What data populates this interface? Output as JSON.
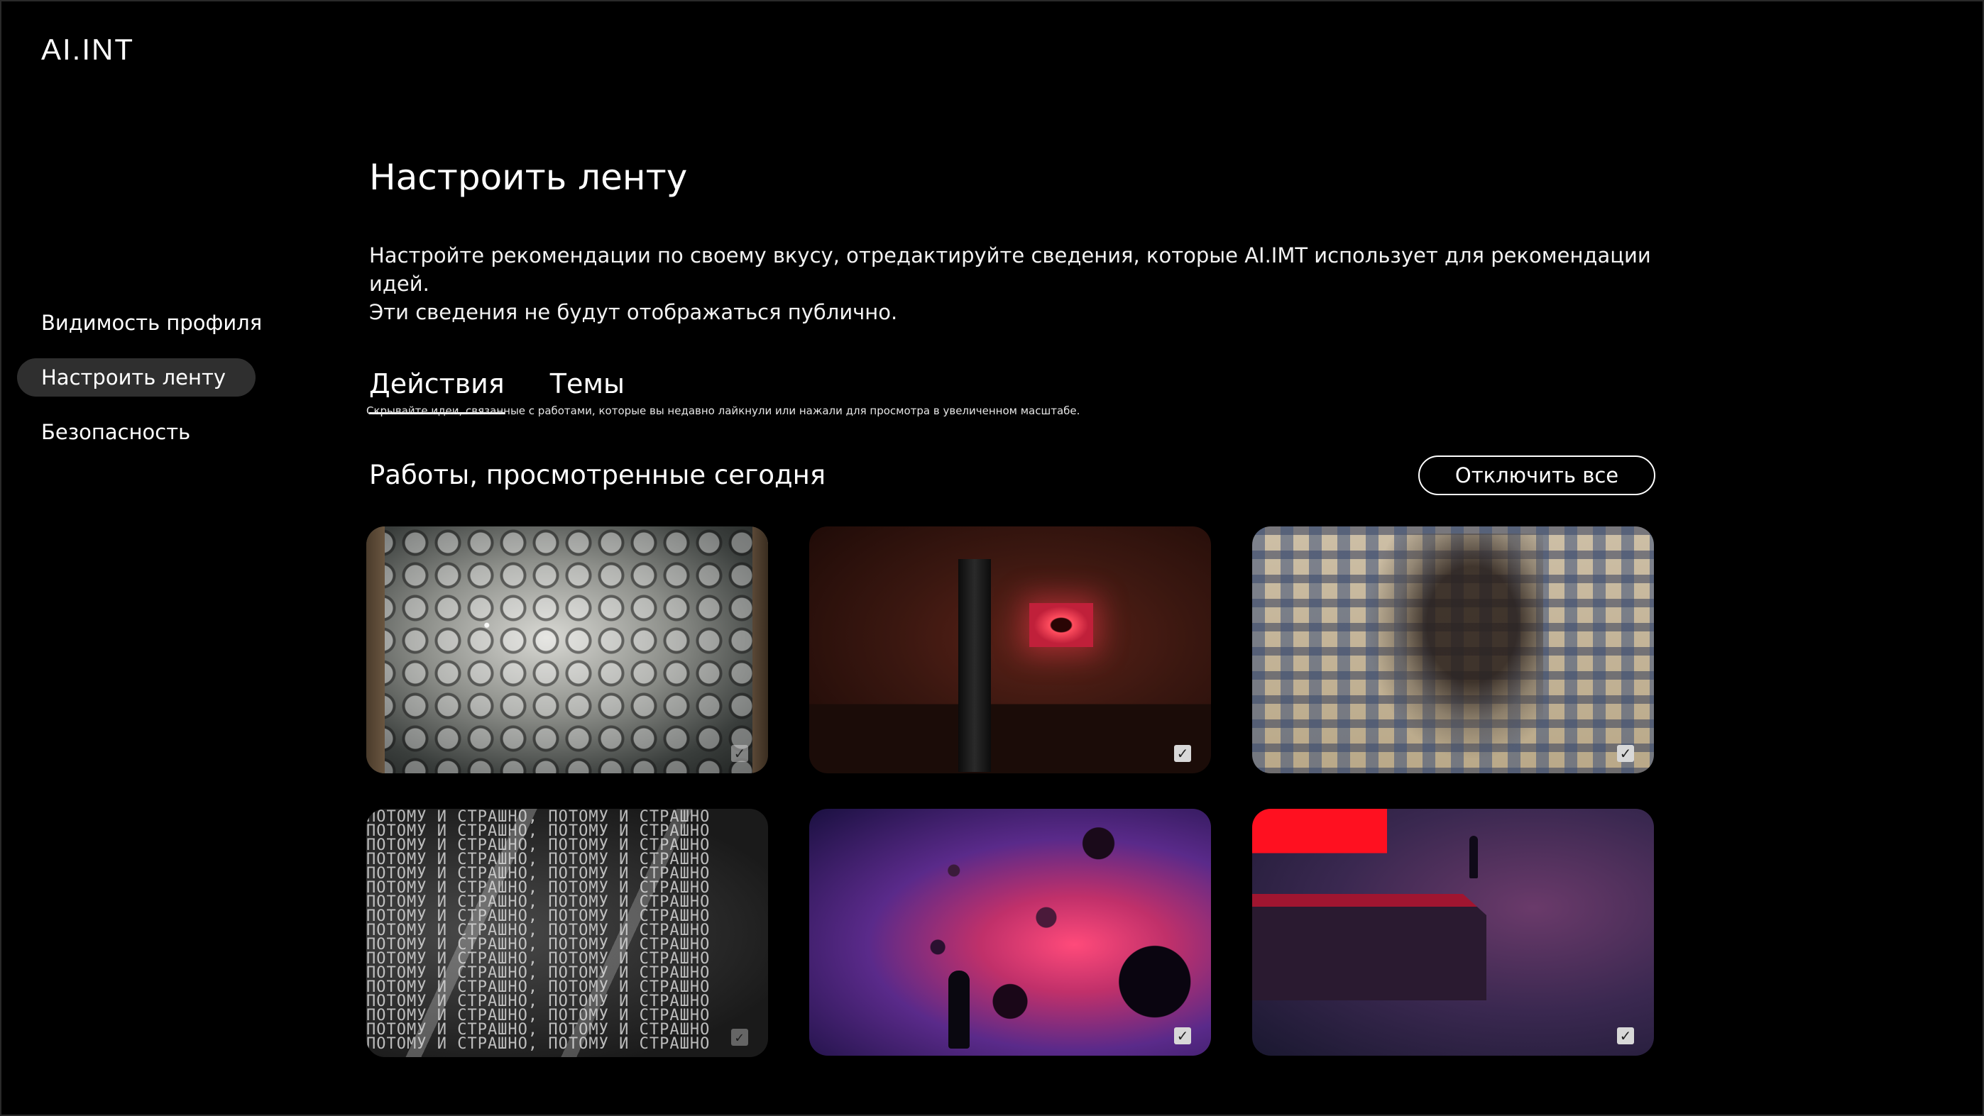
{
  "app": {
    "logo": "AI.INT"
  },
  "sidebar": {
    "items": [
      {
        "label": "Видимость профиля",
        "active": false
      },
      {
        "label": "Настроить ленту",
        "active": true
      },
      {
        "label": "Безопасность",
        "active": false
      }
    ]
  },
  "main": {
    "title": "Настроить ленту",
    "description_line1": "Настройте рекомендации по своему вкусу, отредактируйте сведения, которые AI.IMT использует для рекомендации идей.",
    "description_line2": "Эти сведения не будут отображаться публично.",
    "tabs": [
      {
        "label": "Действия",
        "active": true
      },
      {
        "label": "Темы",
        "active": false
      }
    ],
    "hint": "Скрывайте идеи, связанные с работами, которые вы недавно лайкнули или нажали для просмотра в увеличенном масштабе.",
    "section_title": "Работы, просмотренные сегодня",
    "disable_all_label": "Отключить все",
    "card_text_line": "ПОТОМУ И СТРАШНО, ПОТОМУ И СТРАШНО",
    "check_glyph": "✓"
  },
  "colors": {
    "background": "#000000",
    "active_item": "#2f2f2f",
    "text": "#ffffff"
  }
}
